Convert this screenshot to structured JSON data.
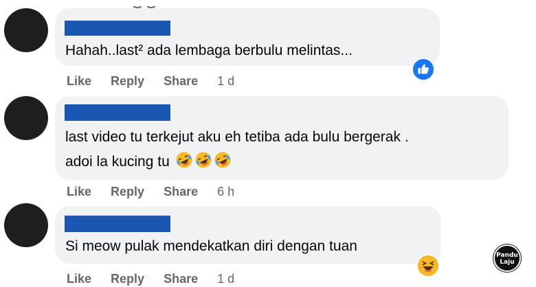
{
  "comments": [
    {
      "text_lines": [
        "Hahah..last² ada lembaga berbulu melintas..."
      ],
      "emoji": [],
      "actions": {
        "like": "Like",
        "reply": "Reply",
        "share": "Share",
        "time": "1 d"
      },
      "reaction": "like-icon"
    },
    {
      "text_lines": [
        "last video tu terkejut aku eh tetiba ada bulu bergerak .",
        "adoi la kucing tu"
      ],
      "emoji": [
        "rofl-emoji",
        "rofl-emoji",
        "rofl-emoji"
      ],
      "actions": {
        "like": "Like",
        "reply": "Reply",
        "share": "Share",
        "time": "6 h"
      },
      "reaction": null
    },
    {
      "text_lines": [
        "Si meow pulak mendekatkan diri dengan tuan"
      ],
      "emoji": [],
      "actions": {
        "like": "Like",
        "reply": "Reply",
        "share": "Share",
        "time": "1 d"
      },
      "reaction": "haha-icon"
    }
  ],
  "watermark": {
    "line1": "Pandu",
    "line2": "Laju"
  },
  "colors": {
    "bubble": "#f0f2f5",
    "name_redaction": "#1b56b5",
    "like_blue": "#1877f2",
    "haha_yellow": "#f7b928",
    "meta_grey": "#65676b"
  }
}
